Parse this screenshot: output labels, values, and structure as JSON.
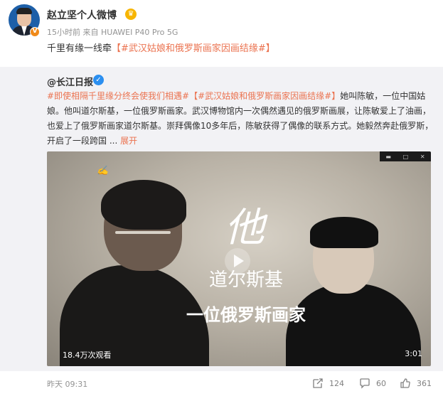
{
  "post": {
    "author": "赵立坚个人微博",
    "meta": "15小时前 来自 HUAWEI P40 Pro 5G",
    "text_prefix": "千里有缘一线牵",
    "text_hashtag": "【#武汉姑娘和俄罗斯画家因画结缘#】"
  },
  "repost": {
    "author": "@长江日报",
    "text_hashtag1": "#即使相隔千里缘分终会使我们相遇#",
    "text_hashtag2": "【#武汉姑娘和俄罗斯画家因画结缘#】",
    "text_body": "她叫陈敏，一位中国姑娘。他叫道尔斯基，一位俄罗斯画家。武汉博物馆内一次偶然遇见的俄罗斯画展，让陈敏爱上了油画，也爱上了俄罗斯画家道尔斯基。崇拜偶像10多年后，陈敏获得了偶像的联系方式。她毅然奔赴俄罗斯，开启了一段跨国",
    "ellipsis": "...",
    "expand_label": "展开"
  },
  "video": {
    "caption_main": "他",
    "caption_name": "道尔斯基",
    "caption_title": "一位俄罗斯画家",
    "views": "18.4万次观看",
    "duration": "3:01",
    "controls": [
      "▬",
      "□",
      "✕"
    ]
  },
  "footer": {
    "time": "昨天 09:31",
    "share_count": "124",
    "comment_count": "60",
    "like_count": "361"
  },
  "colors": {
    "hashtag": "#eb7350",
    "verified_orange": "#f08a19",
    "verified_blue": "#2b8ff0",
    "crown": "#f7b500",
    "repost_bg": "#f2f2f5"
  },
  "icons": [
    "verified-v-icon",
    "crown-member-icon",
    "play-icon",
    "share-icon",
    "comment-icon",
    "like-icon"
  ]
}
